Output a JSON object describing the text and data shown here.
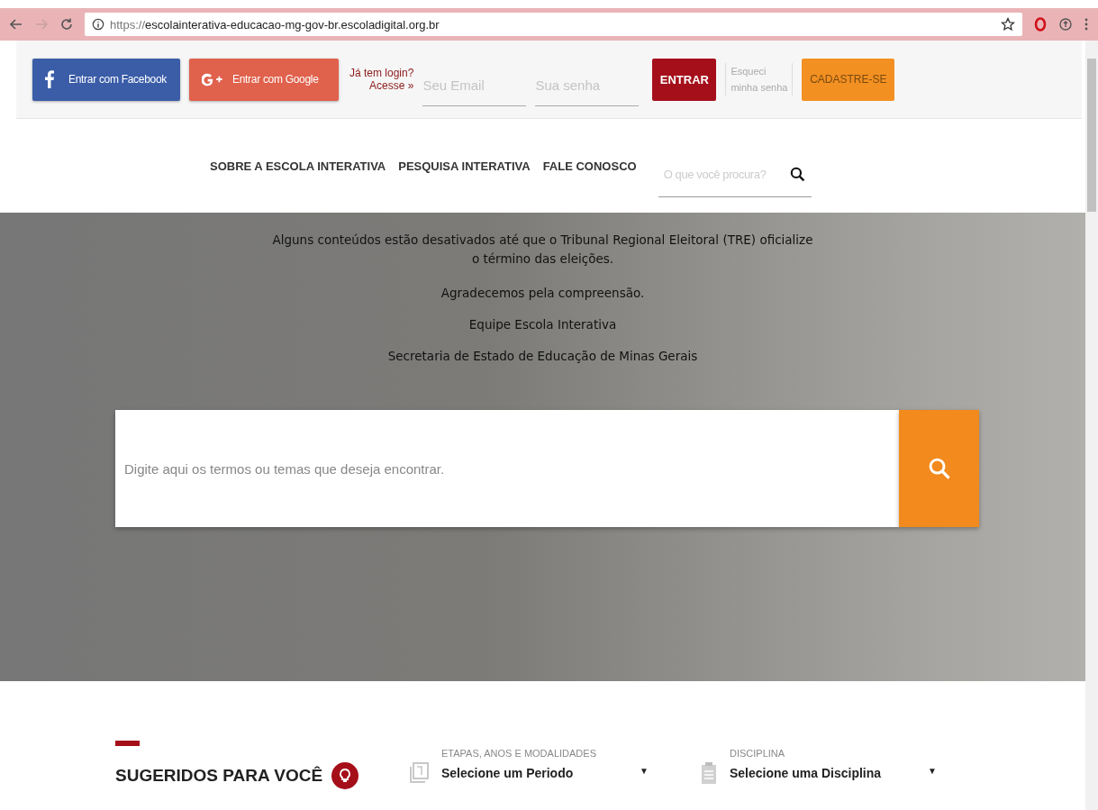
{
  "browser": {
    "url_scheme": "https://",
    "url_rest": "escolainterativa-educacao-mg-gov-br.escoladigital.org.br"
  },
  "login_bar": {
    "facebook_button": "Entrar com Facebook",
    "google_button": "Entrar com Google",
    "login_prompt": "Já tem login?",
    "login_link": "Acesse »",
    "email": {
      "placeholder": "Seu Email"
    },
    "password": {
      "placeholder": "Sua senha"
    },
    "submit_button": "ENTRAR",
    "forgot_link": [
      "Esqueci",
      "minha senha"
    ],
    "signup_button": "CADASTRE-SE"
  },
  "nav": {
    "items": [
      {
        "label": "SOBRE A ESCOLA INTERATIVA"
      },
      {
        "label": "PESQUISA INTERATIVA"
      },
      {
        "label": "FALE CONOSCO"
      }
    ],
    "search": {
      "placeholder": "O que você procura?"
    }
  },
  "notice": {
    "lines": [
      "Alguns conteúdos estão desativados até que o Tribunal Regional Eleitoral (TRE) oficialize",
      "o término das eleições."
    ],
    "paragraphs": [
      "Agradecemos pela compreensão.",
      "Equipe Escola Interativa",
      "Secretaria de Estado de Educação de Minas Gerais"
    ]
  },
  "main_search": {
    "placeholder": "Digite aqui os termos ou temas que deseja encontrar."
  },
  "suggested": {
    "title": "SUGERIDOS PARA VOCÊ",
    "filters": [
      {
        "kind": "period",
        "label": "ETAPAS, ANOS E MODALIDADES",
        "value": "Selecione um Periodo",
        "caret": "▼"
      },
      {
        "kind": "subject",
        "label": "DISCIPLINA",
        "value": "Selecione uma Disciplina",
        "caret": "▼"
      }
    ]
  }
}
